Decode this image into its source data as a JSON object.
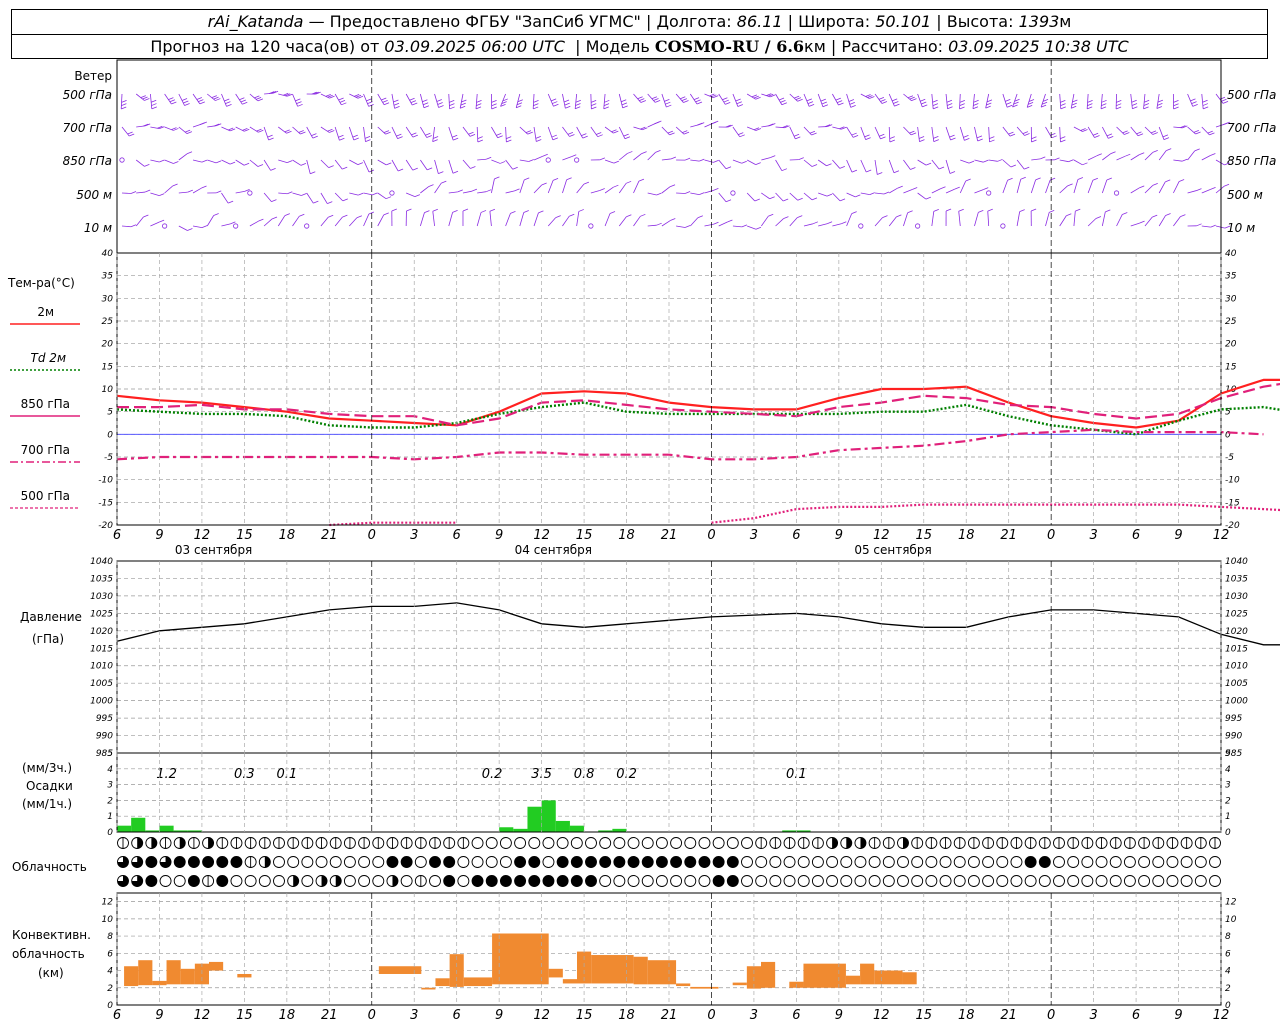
{
  "header": {
    "station": "rAi_Katanda",
    "provider": "Предоставлено ФГБУ \"ЗапСиб УГМС\"",
    "lon_label": "Долгота:",
    "lon": "86.11",
    "lat_label": "Широта:",
    "lat": "50.101",
    "alt_label": "Высота:",
    "alt": "1393",
    "alt_unit": "м",
    "forecast_prefix": "Прогноз на 120 часа(ов) от",
    "forecast_start": "03.09.2025 06:00 UTC",
    "model_label": "Модель",
    "model": "COSMO-RU / 6.6",
    "model_unit": "км",
    "calc_label": "Рассчитано:",
    "calc_time": "03.09.2025 10:38 UTC"
  },
  "wind_panel": {
    "title": "Ветер",
    "levels": [
      "500 гПа",
      "700 гПа",
      "850 гПа",
      "500 м",
      "10  м"
    ]
  },
  "temp_panel": {
    "title": "Тем-ра(°C)",
    "legend": [
      {
        "label": "2м",
        "color": "#ff2020",
        "style": "solid"
      },
      {
        "label": "Td  2м",
        "color": "#008000",
        "style": "dotted"
      },
      {
        "label": "850 гПа",
        "color": "#e0207a",
        "style": "dash"
      },
      {
        "label": "700 гПа",
        "color": "#e0207a",
        "style": "dashdot"
      },
      {
        "label": "500 гПа",
        "color": "#e0207a",
        "style": "dotted"
      }
    ]
  },
  "pressure_panel": {
    "title": "Давление",
    "unit": "(гПа)"
  },
  "precip_panel": {
    "unit3": "(мм/3ч.)",
    "title": "Осадки",
    "unit1": "(мм/1ч.)",
    "totals": [
      {
        "h": 3.5,
        "v": "1.2"
      },
      {
        "h": 9,
        "v": "0.3"
      },
      {
        "h": 12,
        "v": "0.1"
      },
      {
        "h": 26.5,
        "v": "0.2"
      },
      {
        "h": 30,
        "v": "3.5"
      },
      {
        "h": 33,
        "v": "0.8"
      },
      {
        "h": 36,
        "v": "0.2"
      },
      {
        "h": 48,
        "v": "0.1"
      }
    ]
  },
  "cloud_panel": {
    "title": "Облачность"
  },
  "conv_panel": {
    "title1": "Конвективн.",
    "title2": "облачность",
    "unit": "(км)"
  },
  "x_axis": {
    "hour_labels": [
      "6",
      "9",
      "12",
      "15",
      "18",
      "21",
      "0",
      "3",
      "6",
      "9",
      "12",
      "15",
      "18",
      "21",
      "0",
      "3",
      "6",
      "9",
      "12",
      "15",
      "18",
      "21",
      "0",
      "3",
      "6",
      "9",
      "12"
    ],
    "days": [
      {
        "label": "03 сентября",
        "h": 4
      },
      {
        "label": "04 сентября",
        "h": 28
      },
      {
        "label": "05 сентября",
        "h": 52
      }
    ]
  },
  "colors": {
    "t2m": "#ff2020",
    "td": "#008000",
    "upper": "#e0207a",
    "wind": "#8a2be2",
    "precip": "#22cc22",
    "conv": "#f08a30",
    "zero": "#4040ff"
  },
  "chart_data": [
    {
      "type": "line",
      "title": "Тем-ра(°C)",
      "x_unit": "hours from 03.09.2025 06:00 UTC",
      "x": [
        0,
        3,
        6,
        9,
        12,
        15,
        18,
        21,
        24,
        27,
        30,
        33,
        36,
        39,
        42,
        45,
        48,
        51,
        54,
        57,
        60,
        63,
        66,
        69,
        72,
        75,
        78
      ],
      "ylim": [
        -20,
        40
      ],
      "series": [
        {
          "name": "2м",
          "values": [
            8.5,
            7.5,
            7,
            6,
            5,
            3.5,
            3,
            2.5,
            2,
            5,
            9,
            9.5,
            9,
            7,
            6,
            5.5,
            5.5,
            8,
            10,
            10,
            10.5,
            7,
            4,
            2.5,
            1.5,
            3,
            9,
            12,
            12
          ]
        },
        {
          "name": "Td  2м",
          "values": [
            5.5,
            5,
            4.5,
            4.5,
            4,
            2,
            1.5,
            1.5,
            2.5,
            4.5,
            6,
            7,
            5,
            4.5,
            4.5,
            4.5,
            4.5,
            4.5,
            5,
            5,
            6.5,
            4,
            2,
            1,
            0,
            3,
            5.5,
            6,
            4.5
          ]
        },
        {
          "name": "850 гПа",
          "values": [
            6,
            6,
            6.5,
            5.5,
            5.5,
            4.5,
            4,
            4,
            2,
            3.5,
            7,
            7.5,
            6.5,
            5.5,
            5,
            4.5,
            4,
            6,
            7,
            8.5,
            8,
            6.5,
            6,
            4.5,
            3.5,
            4.5,
            8,
            10.5,
            12
          ]
        },
        {
          "name": "700 гПа",
          "values": [
            -5.5,
            -5,
            -5,
            -5,
            -5,
            -5,
            -5,
            -5.5,
            -5,
            -4,
            -4,
            -4.5,
            -4.5,
            -4.5,
            -5.5,
            -5.5,
            -5,
            -3.5,
            -3,
            -2.5,
            -1.5,
            0,
            0.5,
            1,
            0.5,
            0.5,
            0.5,
            0
          ]
        },
        {
          "name": "500 гПа",
          "values": [
            null,
            null,
            null,
            null,
            null,
            -20,
            -19.5,
            -19.5,
            -19.5,
            null,
            null,
            null,
            null,
            null,
            -19.5,
            -18.5,
            -16.5,
            -16,
            -16,
            -15.5,
            -15.5,
            -15.5,
            -15.5,
            -15.5,
            -15.5,
            -15.5,
            -16,
            -16.5,
            -17
          ]
        }
      ],
      "x_values_per_series": [
        0,
        3,
        6,
        9,
        12,
        15,
        18,
        21,
        24,
        27,
        30,
        33,
        36,
        39,
        42,
        45,
        48,
        51,
        54,
        57,
        60,
        63,
        66,
        69,
        72,
        75,
        78,
        81,
        84
      ]
    },
    {
      "type": "line",
      "title": "Давление",
      "ylabel": "(гПа)",
      "x_unit": "hours from 03.09.2025 06:00 UTC",
      "x": [
        0,
        3,
        6,
        9,
        12,
        15,
        18,
        21,
        24,
        27,
        30,
        33,
        36,
        39,
        42,
        45,
        48,
        51,
        54,
        57,
        60,
        63,
        66,
        69,
        72,
        75,
        78,
        81,
        84
      ],
      "ylim": [
        985,
        1040
      ],
      "series": [
        {
          "name": "Давление",
          "values": [
            1017,
            1020,
            1021,
            1022,
            1024,
            1026,
            1027,
            1027,
            1028,
            1026,
            1022,
            1021,
            1022,
            1023,
            1024,
            1024.5,
            1025,
            1024,
            1022,
            1021,
            1021,
            1024,
            1026,
            1026,
            1025,
            1024,
            1019,
            1016,
            1016
          ]
        }
      ]
    },
    {
      "type": "bar",
      "title": "Осадки",
      "ylabel": "(мм/1ч.)",
      "x_unit": "hours from 03.09.2025 06:00 UTC",
      "ylim": [
        0,
        5
      ],
      "x": [
        0,
        1,
        2,
        3,
        4,
        5,
        6,
        7,
        8,
        9,
        10,
        11,
        12,
        13,
        14,
        15,
        16,
        17,
        18,
        19,
        20,
        21,
        22,
        23,
        24,
        25,
        26,
        27,
        28,
        29,
        30,
        31,
        32,
        33,
        34,
        35,
        36,
        37,
        38,
        39,
        40,
        41,
        42,
        43,
        44,
        45,
        46,
        47,
        48,
        49,
        50
      ],
      "values": [
        0.4,
        0.9,
        0.1,
        0.4,
        0.1,
        0.1,
        0,
        0,
        0,
        0,
        0,
        0,
        0,
        0,
        0,
        0,
        0,
        0,
        0,
        0,
        0,
        0,
        0,
        0,
        0,
        0,
        0,
        0.3,
        0.2,
        1.6,
        2.0,
        0.7,
        0.4,
        0,
        0.1,
        0.2,
        0,
        0,
        0,
        0,
        0,
        0,
        0,
        0,
        0,
        0,
        0,
        0.1,
        0.1,
        0,
        0
      ]
    },
    {
      "type": "bar",
      "title": "Конвективн. облачность",
      "ylabel": "(км)",
      "x_unit": "hours from 03.09.2025 06:00 UTC",
      "ylim": [
        0,
        13
      ],
      "bars": [
        {
          "x0": 0.5,
          "x1": 1.5,
          "base": 2.2,
          "top": 4.5
        },
        {
          "x0": 1.5,
          "x1": 2.5,
          "base": 2.3,
          "top": 5.2
        },
        {
          "x0": 2.5,
          "x1": 3.5,
          "base": 2.3,
          "top": 2.8
        },
        {
          "x0": 3.5,
          "x1": 4.5,
          "base": 2.4,
          "top": 5.2
        },
        {
          "x0": 4.5,
          "x1": 5.5,
          "base": 2.4,
          "top": 4.2
        },
        {
          "x0": 5.5,
          "x1": 6.5,
          "base": 2.4,
          "top": 4.8
        },
        {
          "x0": 6.5,
          "x1": 7.5,
          "base": 4.0,
          "top": 5.0
        },
        {
          "x0": 8.5,
          "x1": 9.5,
          "base": 3.2,
          "top": 3.6
        },
        {
          "x0": 18.5,
          "x1": 21.5,
          "base": 3.6,
          "top": 4.5
        },
        {
          "x0": 21.5,
          "x1": 22.5,
          "base": 1.8,
          "top": 2.0
        },
        {
          "x0": 22.5,
          "x1": 23.5,
          "base": 2.2,
          "top": 3.1
        },
        {
          "x0": 23.5,
          "x1": 24.5,
          "base": 2.1,
          "top": 5.9
        },
        {
          "x0": 24.5,
          "x1": 26.5,
          "base": 2.2,
          "top": 3.2
        },
        {
          "x0": 26.5,
          "x1": 30.5,
          "base": 2.4,
          "top": 8.3
        },
        {
          "x0": 30.5,
          "x1": 31.5,
          "base": 3.2,
          "top": 4.2
        },
        {
          "x0": 31.5,
          "x1": 32.5,
          "base": 2.5,
          "top": 3.0
        },
        {
          "x0": 32.5,
          "x1": 33.5,
          "base": 2.5,
          "top": 6.2
        },
        {
          "x0": 33.5,
          "x1": 36.5,
          "base": 2.5,
          "top": 5.8
        },
        {
          "x0": 36.5,
          "x1": 37.5,
          "base": 2.4,
          "top": 5.6
        },
        {
          "x0": 37.5,
          "x1": 39.5,
          "base": 2.4,
          "top": 5.2
        },
        {
          "x0": 39.5,
          "x1": 40.5,
          "base": 2.2,
          "top": 2.5
        },
        {
          "x0": 40.5,
          "x1": 42.5,
          "base": 1.9,
          "top": 2.1
        },
        {
          "x0": 43.5,
          "x1": 44.5,
          "base": 2.3,
          "top": 2.6
        },
        {
          "x0": 44.5,
          "x1": 45.5,
          "base": 1.9,
          "top": 4.5
        },
        {
          "x0": 45.5,
          "x1": 46.5,
          "base": 2.0,
          "top": 5.0
        },
        {
          "x0": 47.5,
          "x1": 48.5,
          "base": 2.0,
          "top": 2.7
        },
        {
          "x0": 48.5,
          "x1": 51.5,
          "base": 2.0,
          "top": 4.8
        },
        {
          "x0": 51.5,
          "x1": 52.5,
          "base": 2.4,
          "top": 3.4
        },
        {
          "x0": 52.5,
          "x1": 53.5,
          "base": 2.4,
          "top": 4.8
        },
        {
          "x0": 53.5,
          "x1": 55.5,
          "base": 2.4,
          "top": 4.0
        },
        {
          "x0": 55.5,
          "x1": 56.5,
          "base": 2.4,
          "top": 3.8
        }
      ]
    },
    {
      "type": "table",
      "title": "Облачность",
      "x_unit": "hours from 03.09.2025 06:00 UTC",
      "rows": [
        {
          "name": "upper",
          "cover_0_to_4": "1221212111111111111111111000000000000000000001111122211211111111111111111111111111114433344"
        },
        {
          "name": "middle",
          "cover_0_to_4": "3343444441200000000440440000440444444444444400000000000000000000440000000000000000000020000000001114"
        },
        {
          "name": "lower",
          "cover_0_to_4": "3340041400002022000201040444444444000000004400000000000000000000000000000000000000000000000"
        }
      ]
    }
  ]
}
